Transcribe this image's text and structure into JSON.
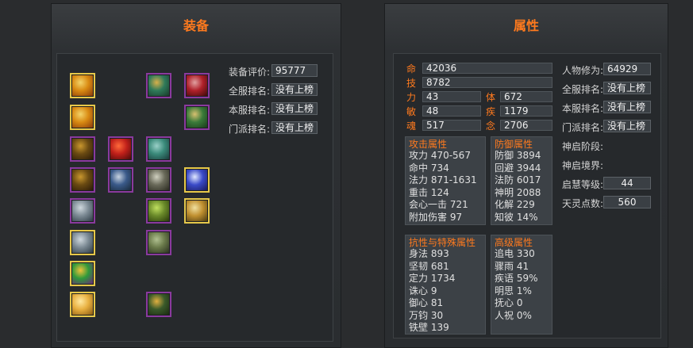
{
  "equipment": {
    "title": "装备",
    "ranks": [
      {
        "label": "装备评价:",
        "value": "95777"
      },
      {
        "label": "全服排名:",
        "value": "没有上榜"
      },
      {
        "label": "本服排名:",
        "value": "没有上榜"
      },
      {
        "label": "门派排名:",
        "value": "没有上榜"
      }
    ],
    "slots": [
      {
        "name": "amulet-icon",
        "border": "gold",
        "colors": [
          "#d98a12",
          "#f3d46a",
          "#8a3a0a"
        ]
      },
      {
        "name": "amulet-icon",
        "border": "gold",
        "colors": [
          "#d98a12",
          "#f3d46a",
          "#8a3a0a"
        ]
      },
      {
        "name": "ring-icon",
        "border": "purple",
        "colors": [
          "#6a4a12",
          "#c9972e",
          "#2a1a08"
        ]
      },
      {
        "name": "ring-icon",
        "border": "purple",
        "colors": [
          "#6a4a12",
          "#c9972e",
          "#2a1a08"
        ]
      },
      {
        "name": "bangle-icon",
        "border": "purple",
        "colors": [
          "#7c8a94",
          "#cfd8de",
          "#2c3a44"
        ]
      },
      {
        "name": "bangle-icon",
        "border": "gold",
        "colors": [
          "#7c8a94",
          "#cfd8de",
          "#2c3a44"
        ]
      },
      {
        "name": "pendant-icon",
        "border": "gold",
        "colors": [
          "#2f9a3a",
          "#f0c23a",
          "#6a2a7a"
        ]
      },
      {
        "name": "charm-icon",
        "border": "gold",
        "colors": [
          "#e8b040",
          "#ffe9a0",
          "#8a5a10"
        ]
      },
      {
        "name": "feather-icon",
        "border": "purple",
        "colors": [
          "#c0201a",
          "#ff6a3a",
          "#4a0a0a"
        ]
      },
      {
        "name": "bracer-icon",
        "border": "purple",
        "colors": [
          "#3a5a8a",
          "#c6d2e0",
          "#1a2a3a"
        ]
      },
      {
        "name": "crown-icon",
        "border": "purple",
        "colors": [
          "#2f7a5a",
          "#d8b04a",
          "#1a3a2a"
        ]
      },
      {
        "name": "robe-icon",
        "border": "purple",
        "colors": [
          "#3a8a7a",
          "#9ad0c8",
          "#1a3a3a"
        ]
      },
      {
        "name": "armor-icon",
        "border": "purple",
        "colors": [
          "#6a6a5a",
          "#d0d0c0",
          "#2a2a20"
        ]
      },
      {
        "name": "shoulder-icon",
        "border": "purple",
        "colors": [
          "#6a8a2a",
          "#c0e060",
          "#2a3a0a"
        ]
      },
      {
        "name": "leggings-icon",
        "border": "purple",
        "colors": [
          "#6a7a4a",
          "#b0c090",
          "#2a3020"
        ]
      },
      {
        "name": "boots-icon",
        "border": "purple",
        "colors": [
          "#3a5a2a",
          "#e0b040",
          "#1a2a10"
        ]
      },
      {
        "name": "weapon-icon",
        "border": "purple",
        "colors": [
          "#b0202a",
          "#e0a0a0",
          "#3a0a0a"
        ]
      },
      {
        "name": "gloves-icon",
        "border": "purple",
        "colors": [
          "#3a7a3a",
          "#d8c070",
          "#1a3a1a"
        ]
      },
      {
        "name": "gem-icon",
        "border": "gold",
        "colors": [
          "#3a4ac8",
          "#e0e8ff",
          "#1a1a5a"
        ]
      },
      {
        "name": "belt-icon",
        "border": "gold",
        "colors": [
          "#c09030",
          "#f0e0a0",
          "#4a3a10"
        ]
      }
    ]
  },
  "attributes": {
    "title": "属性",
    "base": [
      {
        "key": "命",
        "value": "42036"
      },
      {
        "key": "技",
        "value": "8782"
      }
    ],
    "pairs": [
      {
        "k1": "力",
        "v1": "43",
        "k2": "体",
        "v2": "672"
      },
      {
        "k1": "敏",
        "v1": "48",
        "k2": "疾",
        "v2": "1179"
      },
      {
        "k1": "魂",
        "v1": "517",
        "k2": "念",
        "v2": "2706"
      }
    ],
    "info": [
      {
        "label": "人物修为:",
        "value": "64929"
      },
      {
        "label": "全服排名:",
        "value": "没有上榜"
      },
      {
        "label": "本服排名:",
        "value": "没有上榜"
      },
      {
        "label": "门派排名:",
        "value": "没有上榜"
      },
      {
        "label": "神启阶段:",
        "value": ""
      },
      {
        "label": "神启境界:",
        "value": ""
      },
      {
        "label": "启慧等级:",
        "value": "44"
      },
      {
        "label": "天灵点数:",
        "value": "560"
      }
    ],
    "attack": {
      "title": "攻击属性",
      "rows": [
        "攻力 470-567",
        "命中 734",
        "法力 871-1631",
        "重击 124",
        "会心一击 721",
        "附加伤害 97"
      ]
    },
    "defense": {
      "title": "防御属性",
      "rows": [
        "防御 3894",
        "回避 3944",
        "法防 6017",
        "神明 2088",
        "化解 229",
        "知彼 14%"
      ]
    },
    "resist": {
      "title": "抗性与特殊属性",
      "rows": [
        "身法 893",
        "坚韧 681",
        "定力 1734",
        "诛心 9",
        "御心 81",
        "万钧 30",
        "铁壁 139"
      ]
    },
    "advanced": {
      "title": "高级属性",
      "rows": [
        "追电 330",
        "骤雨 41",
        "疾语 59%",
        "明思 1%",
        "抚心 0",
        "人祝 0%"
      ]
    }
  },
  "colors": {
    "accent": "#ff7a1e",
    "gold_border": "#e6c84a",
    "purple_border": "#8a3a9e"
  }
}
